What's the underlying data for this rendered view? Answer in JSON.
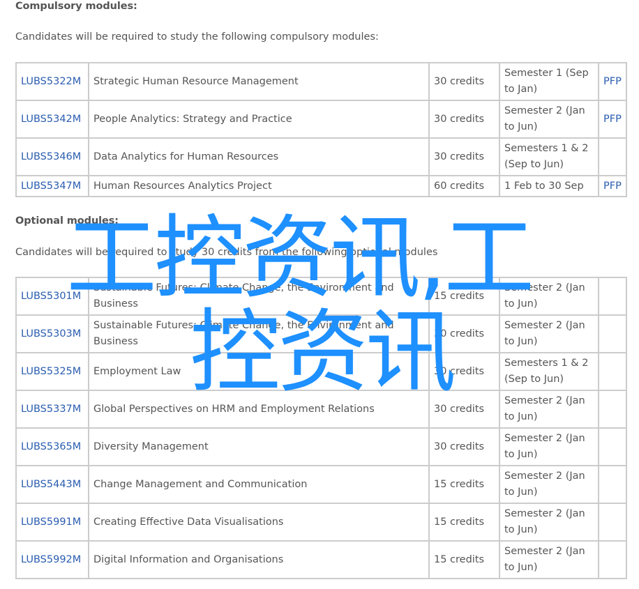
{
  "compulsory": {
    "heading": "Compulsory modules:",
    "intro": "Candidates will be required to study the following compulsory modules:",
    "rows": [
      {
        "code": "LUBS5322M",
        "title": "Strategic Human Resource Management",
        "credits": "30 credits",
        "semester": "Semester 1 (Sep to Jan)",
        "pfp": "PFP"
      },
      {
        "code": "LUBS5342M",
        "title": "People Analytics: Strategy and Practice",
        "credits": "30 credits",
        "semester": "Semester 2 (Jan to Jun)",
        "pfp": "PFP"
      },
      {
        "code": "LUBS5346M",
        "title": "Data Analytics for Human Resources",
        "credits": "30 credits",
        "semester": "Semesters 1 & 2 (Sep to Jun)",
        "pfp": ""
      },
      {
        "code": "LUBS5347M",
        "title": "Human Resources Analytics Project",
        "credits": "60 credits",
        "semester": "1 Feb to 30 Sep",
        "pfp": "PFP"
      }
    ]
  },
  "optional": {
    "heading": "Optional modules:",
    "intro": "Candidates will be required to study 30 credits from the following optional modules",
    "rows": [
      {
        "code": "LUBS5301M",
        "title": "Sustainable Futures: Climate Change, the Environment and Business",
        "credits": "15 credits",
        "semester": "Semester 2 (Jan to Jun)",
        "pfp": ""
      },
      {
        "code": "LUBS5303M",
        "title": "Sustainable Futures: Climate Change, the Environment and Business",
        "credits": "30 credits",
        "semester": "Semester 2 (Jan to Jun)",
        "pfp": ""
      },
      {
        "code": "LUBS5325M",
        "title": "Employment Law",
        "credits": "30 credits",
        "semester": "Semesters 1 & 2 (Sep to Jun)",
        "pfp": ""
      },
      {
        "code": "LUBS5337M",
        "title": "Global Perspectives on HRM and Employment Relations",
        "credits": "30 credits",
        "semester": "Semester 2 (Jan to Jun)",
        "pfp": ""
      },
      {
        "code": "LUBS5365M",
        "title": "Diversity Management",
        "credits": "30 credits",
        "semester": "Semester 2 (Jan to Jun)",
        "pfp": ""
      },
      {
        "code": "LUBS5443M",
        "title": "Change Management and Communication",
        "credits": "15 credits",
        "semester": "Semester 2 (Jan to Jun)",
        "pfp": ""
      },
      {
        "code": "LUBS5991M",
        "title": "Creating Effective Data Visualisations",
        "credits": "15 credits",
        "semester": "Semester 2 (Jan to Jun)",
        "pfp": ""
      },
      {
        "code": "LUBS5992M",
        "title": "Digital Information and Organisations",
        "credits": "15 credits",
        "semester": "Semester 2 (Jan to Jun)",
        "pfp": ""
      }
    ]
  },
  "watermark": {
    "line1": "工控资讯,工",
    "line2": "控资讯",
    "color": "#1e90ff"
  },
  "colors": {
    "text": "#555555",
    "link": "#2a5db0",
    "border": "#cccccc"
  }
}
